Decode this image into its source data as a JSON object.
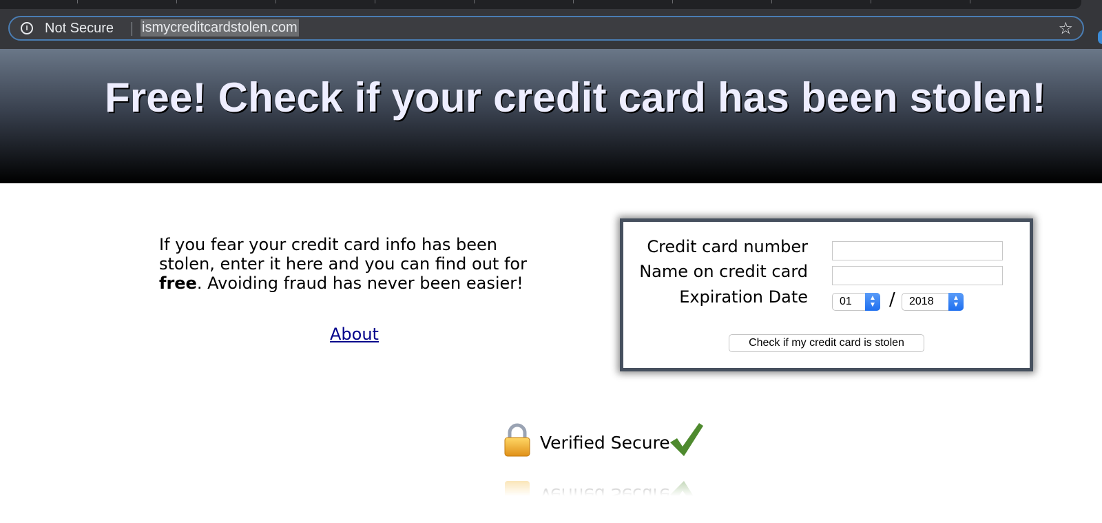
{
  "browser": {
    "security_label": "Not Secure",
    "url": "ismycreditcardstolen.com",
    "icons": {
      "info": "info-icon",
      "bookmark": "star-icon"
    }
  },
  "banner": {
    "headline": "Free! Check if your credit card has been stolen!"
  },
  "intro": {
    "text_before": "If you fear your credit card info has been stolen, enter it here and you can find out for ",
    "bold": "free",
    "text_after": ". Avoiding fraud has never been easier!"
  },
  "links": {
    "about": "About"
  },
  "form": {
    "card_number_label": "Credit card number",
    "card_number_value": "",
    "name_label": "Name on credit card",
    "name_value": "",
    "expiration_label": "Expiration Date",
    "month": "01",
    "separator": "/",
    "year": "2018",
    "submit_label": "Check if my credit card is stolen"
  },
  "badge": {
    "text": "Verified Secure",
    "icons": [
      "lock-icon",
      "checkmark-icon"
    ]
  },
  "colors": {
    "omnibox_focus": "#4a7db3",
    "headline": "#eeeeff",
    "link": "#00008b",
    "form_border": "#46505e",
    "select_accent": "#1e6ff0",
    "check": "#4e8a2e",
    "lock": "#f2b32c"
  }
}
